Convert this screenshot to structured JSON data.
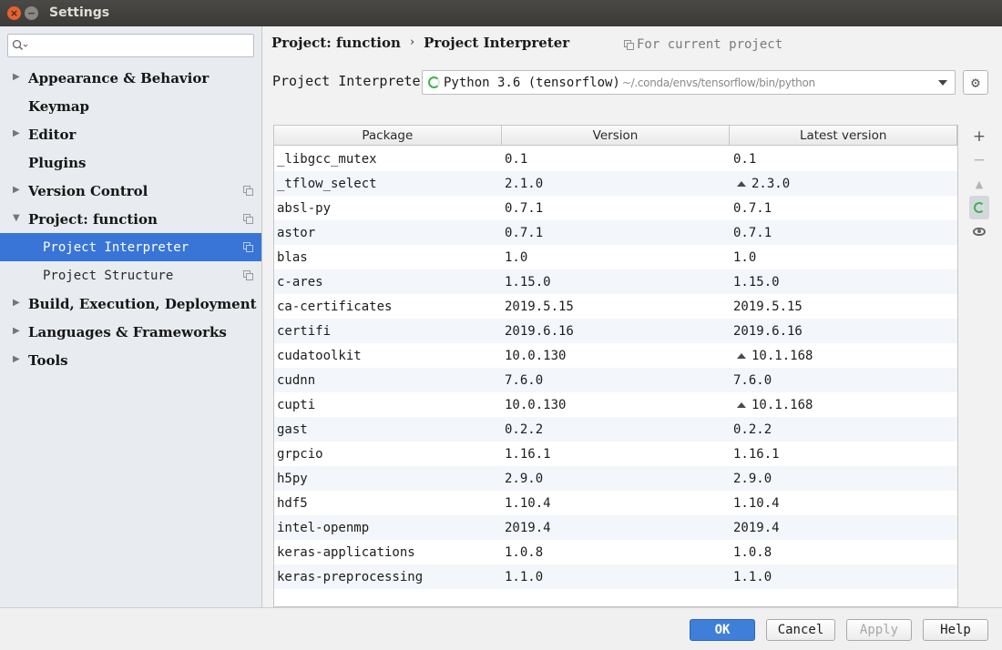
{
  "window": {
    "title": "Settings"
  },
  "search": {
    "placeholder": ""
  },
  "sidebar": {
    "items": [
      {
        "label": "Appearance & Behavior",
        "arrow": "▶",
        "copy": false
      },
      {
        "label": "Keymap",
        "arrow": "",
        "copy": false
      },
      {
        "label": "Editor",
        "arrow": "▶",
        "copy": false
      },
      {
        "label": "Plugins",
        "arrow": "",
        "copy": false
      },
      {
        "label": "Version Control",
        "arrow": "▶",
        "copy": true
      },
      {
        "label": "Project: function",
        "arrow": "▼",
        "copy": true
      },
      {
        "label": "Project Interpreter",
        "arrow": "",
        "copy": true,
        "selected": true
      },
      {
        "label": "Project Structure",
        "arrow": "",
        "copy": true
      },
      {
        "label": "Build, Execution, Deployment",
        "arrow": "▶",
        "copy": false
      },
      {
        "label": "Languages & Frameworks",
        "arrow": "▶",
        "copy": false
      },
      {
        "label": "Tools",
        "arrow": "▶",
        "copy": false
      }
    ]
  },
  "main": {
    "breadcrumb": {
      "project": "Project: function",
      "separator": "›",
      "page": "Project Interpreter"
    },
    "for_current_project": "For current project",
    "interpreter": {
      "label": "Project Interpreter:",
      "name": "Python 3.6 (tensorflow)",
      "path": "~/.conda/envs/tensorflow/bin/python"
    },
    "table": {
      "columns": [
        "Package",
        "Version",
        "Latest version"
      ],
      "rows": [
        {
          "package": "_libgcc_mutex",
          "version": "0.1",
          "latest": "0.1",
          "upgrade": false
        },
        {
          "package": "_tflow_select",
          "version": "2.1.0",
          "latest": "2.3.0",
          "upgrade": true
        },
        {
          "package": "absl-py",
          "version": "0.7.1",
          "latest": "0.7.1",
          "upgrade": false
        },
        {
          "package": "astor",
          "version": "0.7.1",
          "latest": "0.7.1",
          "upgrade": false
        },
        {
          "package": "blas",
          "version": "1.0",
          "latest": "1.0",
          "upgrade": false
        },
        {
          "package": "c-ares",
          "version": "1.15.0",
          "latest": "1.15.0",
          "upgrade": false
        },
        {
          "package": "ca-certificates",
          "version": "2019.5.15",
          "latest": "2019.5.15",
          "upgrade": false
        },
        {
          "package": "certifi",
          "version": "2019.6.16",
          "latest": "2019.6.16",
          "upgrade": false
        },
        {
          "package": "cudatoolkit",
          "version": "10.0.130",
          "latest": "10.1.168",
          "upgrade": true
        },
        {
          "package": "cudnn",
          "version": "7.6.0",
          "latest": "7.6.0",
          "upgrade": false
        },
        {
          "package": "cupti",
          "version": "10.0.130",
          "latest": "10.1.168",
          "upgrade": true
        },
        {
          "package": "gast",
          "version": "0.2.2",
          "latest": "0.2.2",
          "upgrade": false
        },
        {
          "package": "grpcio",
          "version": "1.16.1",
          "latest": "1.16.1",
          "upgrade": false
        },
        {
          "package": "h5py",
          "version": "2.9.0",
          "latest": "2.9.0",
          "upgrade": false
        },
        {
          "package": "hdf5",
          "version": "1.10.4",
          "latest": "1.10.4",
          "upgrade": false
        },
        {
          "package": "intel-openmp",
          "version": "2019.4",
          "latest": "2019.4",
          "upgrade": false
        },
        {
          "package": "keras-applications",
          "version": "1.0.8",
          "latest": "1.0.8",
          "upgrade": false
        },
        {
          "package": "keras-preprocessing",
          "version": "1.1.0",
          "latest": "1.1.0",
          "upgrade": false
        }
      ]
    },
    "toolbar": {
      "add": "+",
      "remove": "−",
      "upgrade": "▲"
    }
  },
  "buttons": {
    "ok": "OK",
    "cancel": "Cancel",
    "apply": "Apply",
    "help": "Help"
  },
  "colors": {
    "selection": "#3875d7",
    "ok_button": "#3f7fd9",
    "spinner": "#3fb24b",
    "close_button": "#e9612f"
  }
}
